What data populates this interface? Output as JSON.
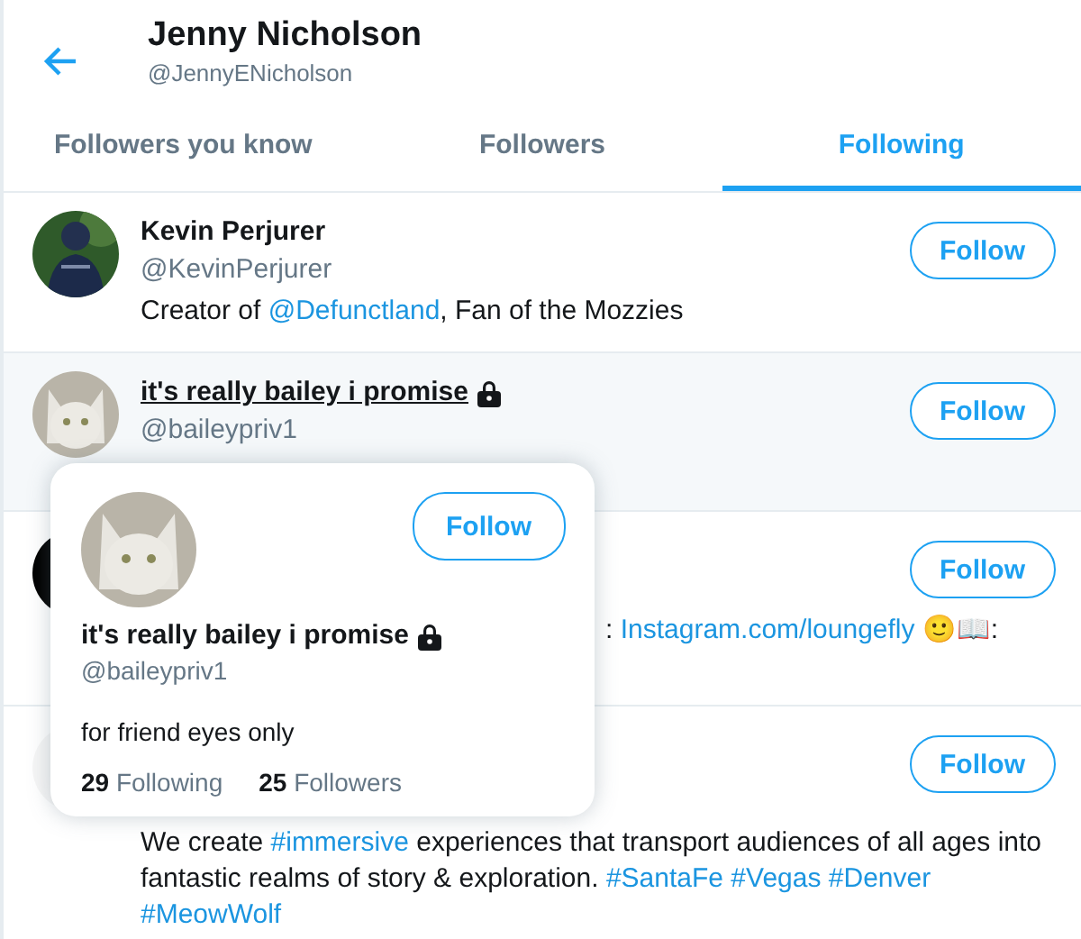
{
  "header": {
    "title": "Jenny Nicholson",
    "handle": "@JennyENicholson"
  },
  "tabs": [
    {
      "label": "Followers you know",
      "selected": false
    },
    {
      "label": "Followers",
      "selected": false
    },
    {
      "label": "Following",
      "selected": true
    }
  ],
  "users": [
    {
      "name": "Kevin Perjurer",
      "handle": "@KevinPerjurer",
      "locked": false,
      "hovered": false,
      "button": "Follow",
      "bio": [
        {
          "kind": "text",
          "text": "Creator of "
        },
        {
          "kind": "link",
          "text": "@Defunctland"
        },
        {
          "kind": "text",
          "text": ", Fan of the Mozzies"
        }
      ]
    },
    {
      "name": "it's really bailey i promise",
      "handle": "@baileypriv1",
      "locked": true,
      "hovered": true,
      "button": "Follow"
    },
    {
      "button": "Follow",
      "bio": [
        {
          "kind": "text",
          "text": ": "
        },
        {
          "kind": "link",
          "text": "Instagram.com/loungefly"
        },
        {
          "kind": "text",
          "text": " 🙂📖:"
        }
      ]
    },
    {
      "button": "Follow",
      "bio": [
        {
          "kind": "text",
          "text": "We create "
        },
        {
          "kind": "link",
          "text": "#immersive"
        },
        {
          "kind": "text",
          "text": " experiences that transport audiences of all ages into fantastic realms of story & exploration."
        }
      ],
      "tags": [
        "#SantaFe",
        "#Vegas",
        "#Denver",
        "#MeowWolf"
      ]
    }
  ],
  "hover_card": {
    "name": "it's really bailey i promise",
    "handle": "@baileypriv1",
    "locked": true,
    "button": "Follow",
    "bio": "for friend eyes only",
    "stats": [
      {
        "count": "29",
        "label": "Following"
      },
      {
        "count": "25",
        "label": "Followers"
      }
    ]
  }
}
